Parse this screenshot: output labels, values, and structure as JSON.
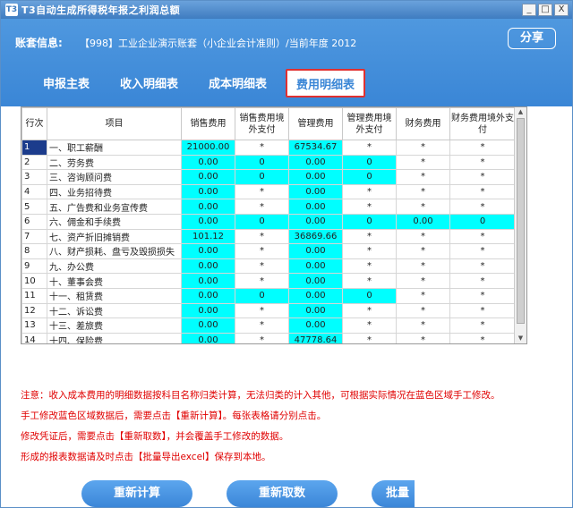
{
  "window": {
    "title": "T3自动生成所得税年报之利润总额",
    "icon": "T3",
    "btn_min": "_",
    "btn_max": "□",
    "btn_close": "X"
  },
  "header": {
    "account_label": "账套信息:",
    "account_value": "【998】工业企业演示账套（小企业会计准则）/当前年度 2012",
    "share_label": "分享"
  },
  "tabs": [
    {
      "label": "申报主表"
    },
    {
      "label": "收入明细表"
    },
    {
      "label": "成本明细表"
    },
    {
      "label": "费用明细表",
      "active": true
    }
  ],
  "table": {
    "headers": [
      "行次",
      "项目",
      "销售费用",
      "销售费用境外支付",
      "管理费用",
      "管理费用境外支付",
      "财务费用",
      "财务费用境外支付"
    ],
    "rows": [
      [
        "1",
        "一、职工薪酬",
        "21000.00",
        "*",
        "67534.67",
        "*",
        "*",
        "*"
      ],
      [
        "2",
        "二、劳务费",
        "0.00",
        "0",
        "0.00",
        "0",
        "*",
        "*"
      ],
      [
        "3",
        "三、咨询顾问费",
        "0.00",
        "0",
        "0.00",
        "0",
        "*",
        "*"
      ],
      [
        "4",
        "四、业务招待费",
        "0.00",
        "*",
        "0.00",
        "*",
        "*",
        "*"
      ],
      [
        "5",
        "五、广告费和业务宣传费",
        "0.00",
        "*",
        "0.00",
        "*",
        "*",
        "*"
      ],
      [
        "6",
        "六、佣金和手续费",
        "0.00",
        "0",
        "0.00",
        "0",
        "0.00",
        "0"
      ],
      [
        "7",
        "七、资产折旧摊销费",
        "101.12",
        "*",
        "36869.66",
        "*",
        "*",
        "*"
      ],
      [
        "8",
        "八、财产损耗、盘亏及毁损损失",
        "0.00",
        "*",
        "0.00",
        "*",
        "*",
        "*"
      ],
      [
        "9",
        "九、办公费",
        "0.00",
        "*",
        "0.00",
        "*",
        "*",
        "*"
      ],
      [
        "10",
        "十、董事会费",
        "0.00",
        "*",
        "0.00",
        "*",
        "*",
        "*"
      ],
      [
        "11",
        "十一、租赁费",
        "0.00",
        "0",
        "0.00",
        "0",
        "*",
        "*"
      ],
      [
        "12",
        "十二、诉讼费",
        "0.00",
        "*",
        "0.00",
        "*",
        "*",
        "*"
      ],
      [
        "13",
        "十三、差旅费",
        "0.00",
        "*",
        "0.00",
        "*",
        "*",
        "*"
      ],
      [
        "14",
        "十四、保险费",
        "0.00",
        "*",
        "47778.64",
        "*",
        "*",
        "*"
      ]
    ],
    "cyan_pattern": [
      [
        1,
        0,
        1,
        0,
        0,
        0
      ],
      [
        1,
        1,
        1,
        1,
        0,
        0
      ],
      [
        1,
        1,
        1,
        1,
        0,
        0
      ],
      [
        1,
        0,
        1,
        0,
        0,
        0
      ],
      [
        1,
        0,
        1,
        0,
        0,
        0
      ],
      [
        1,
        1,
        1,
        1,
        1,
        1
      ],
      [
        1,
        0,
        1,
        0,
        0,
        0
      ],
      [
        1,
        0,
        1,
        0,
        0,
        0
      ],
      [
        1,
        0,
        1,
        0,
        0,
        0
      ],
      [
        1,
        0,
        1,
        0,
        0,
        0
      ],
      [
        1,
        1,
        1,
        1,
        0,
        0
      ],
      [
        1,
        0,
        1,
        0,
        0,
        0
      ],
      [
        1,
        0,
        1,
        0,
        0,
        0
      ],
      [
        1,
        0,
        1,
        0,
        0,
        0
      ]
    ]
  },
  "notes": [
    "注意：收入成本费用的明细数据按科目名称归类计算，无法归类的计入其他，可根据实际情况在蓝色区域手工修改。",
    "手工修改蓝色区域数据后，需要点击【重新计算】。每张表格请分别点击。",
    "修改凭证后，需要点击【重新取数】，并会覆盖手工修改的数据。",
    "形成的报表数据请及时点击【批量导出excel】保存到本地。"
  ],
  "actions": {
    "recalc": "重新计算",
    "refetch": "重新取数",
    "export": "批量"
  }
}
